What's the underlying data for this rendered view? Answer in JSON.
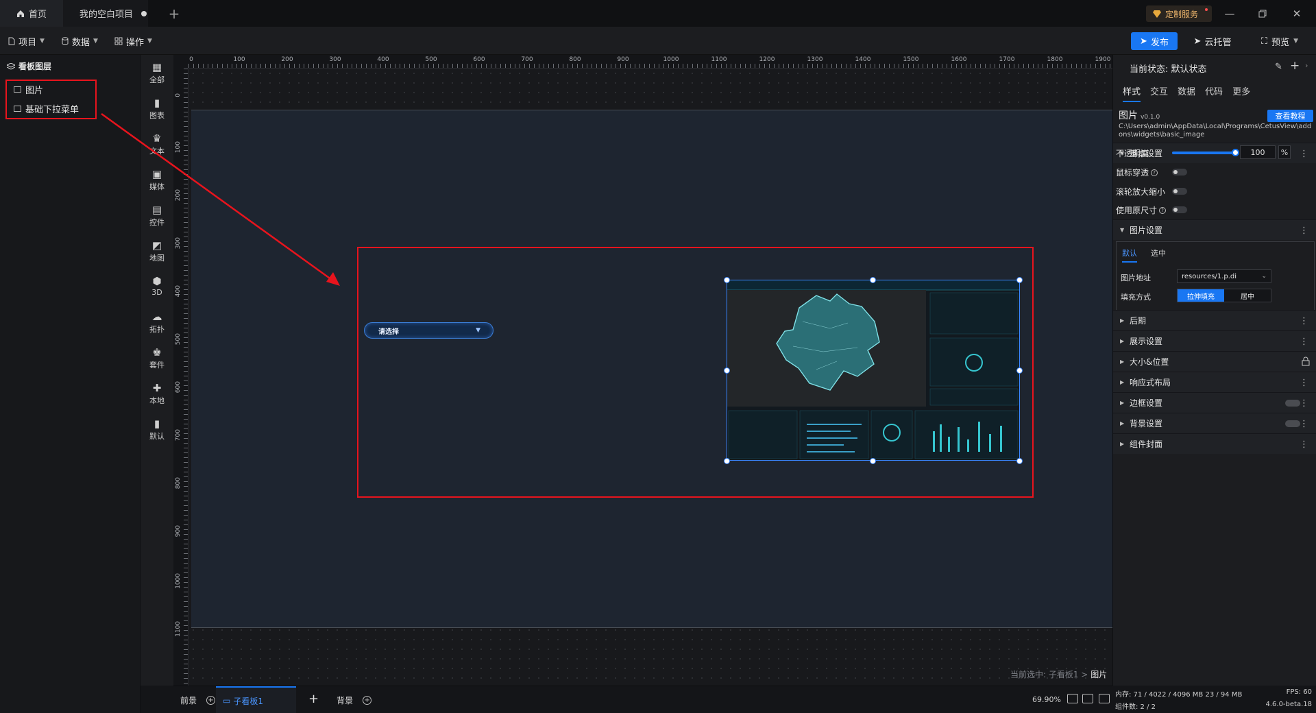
{
  "tabs": {
    "home": "首页",
    "project": "我的空白项目"
  },
  "topbar": {
    "custom_service": "定制服务"
  },
  "menu": {
    "project": "项目",
    "data": "数据",
    "operate": "操作",
    "publish": "发布",
    "cloud": "云托管",
    "preview": "预览"
  },
  "layers": {
    "title": "看板图层",
    "items": [
      {
        "label": "图片"
      },
      {
        "label": "基础下拉菜单"
      }
    ]
  },
  "categories": [
    {
      "label": "全部",
      "icon": "grid-icon"
    },
    {
      "label": "图表",
      "icon": "bar-chart-icon"
    },
    {
      "label": "文本",
      "icon": "text-icon"
    },
    {
      "label": "媒体",
      "icon": "media-icon"
    },
    {
      "label": "控件",
      "icon": "control-icon"
    },
    {
      "label": "地图",
      "icon": "map-icon"
    },
    {
      "label": "3D",
      "icon": "cube-icon"
    },
    {
      "label": "拓扑",
      "icon": "topology-icon"
    },
    {
      "label": "套件",
      "icon": "suite-icon"
    },
    {
      "label": "本地",
      "icon": "puzzle-icon"
    },
    {
      "label": "默认",
      "icon": "default-chart-icon"
    }
  ],
  "rulers": {
    "top": [
      "0",
      "100",
      "200",
      "300",
      "400",
      "500",
      "600",
      "700",
      "800",
      "900",
      "1000",
      "1100",
      "1200",
      "1300",
      "1400",
      "1500",
      "1600",
      "1700",
      "1800",
      "1900"
    ],
    "left": [
      "0",
      "100",
      "200",
      "300",
      "400",
      "500",
      "600",
      "700",
      "800",
      "900",
      "1000",
      "1100"
    ]
  },
  "canvas": {
    "dropdown_placeholder": "请选择",
    "selection_prefix": "当前选中: 子看板1 >",
    "selection_target": "图片"
  },
  "bottom": {
    "front": "前景",
    "subboard": "子看板1",
    "background": "背景",
    "zoom": "69.90%"
  },
  "props": {
    "state_label": "当前状态:",
    "state_value": "默认状态",
    "tabs": [
      "样式",
      "交互",
      "数据",
      "代码",
      "更多"
    ],
    "widget_name": "图片",
    "widget_version": "v0.1.0",
    "tutorial": "查看教程",
    "widget_path": "C:\\Users\\admin\\AppData\\Local\\Programs\\CetusView\\addons\\widgets\\basic_image",
    "basic_settings": "基本设置",
    "opacity_label": "不透明度",
    "opacity_value": "100",
    "opacity_unit": "%",
    "opacity": 1.0,
    "mouse_through": "鼠标穿透",
    "wheel_zoom": "滚轮放大缩小",
    "original_size": "使用原尺寸",
    "image_settings": "图片设置",
    "img_state_default": "默认",
    "img_state_selected": "选中",
    "img_address_label": "图片地址",
    "img_address_value": "resources/1.p.di",
    "fill_mode_label": "填充方式",
    "fill_stretch": "拉伸填充",
    "fill_center": "居中",
    "sections": [
      "后期",
      "展示设置",
      "大小&位置",
      "响应式布局",
      "边框设置",
      "背景设置",
      "组件封面"
    ]
  },
  "status": {
    "memory": "内存: 71 / 4022 / 4096 MB  23 / 94 MB",
    "fps": "FPS: 60",
    "component_count": "组件数: 2 / 2",
    "version": "4.6.0-beta.18"
  },
  "colors": {
    "accent": "#1977f3",
    "annotation": "#e8141d",
    "artboard": "#1e2530"
  }
}
